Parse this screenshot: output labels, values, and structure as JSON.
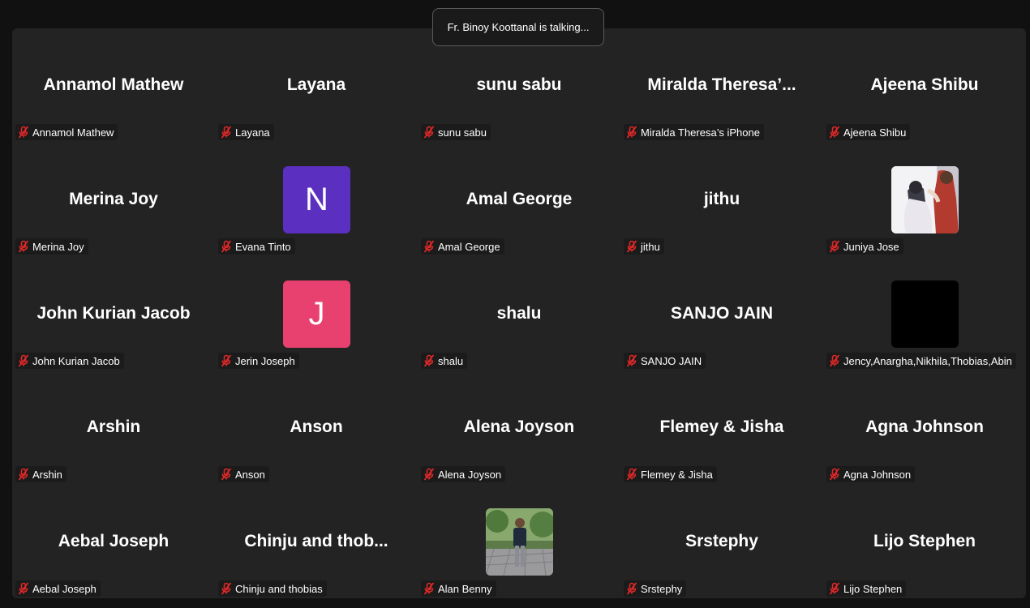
{
  "status": {
    "talking": "Fr. Binoy Koottanal is talking..."
  },
  "colors": {
    "stage": "#232323",
    "mute": "#e02828"
  },
  "tiles": [
    {
      "display": "Annamol Mathew",
      "label": "Annamol Mathew"
    },
    {
      "display": "Layana",
      "label": "Layana"
    },
    {
      "display": "sunu sabu",
      "label": "sunu sabu"
    },
    {
      "display": "Miralda  Theresa’...",
      "label": "Miralda Theresa’s iPhone"
    },
    {
      "display": "Ajeena Shibu",
      "label": "Ajeena Shibu"
    },
    {
      "display": "Merina Joy",
      "label": "Merina Joy"
    },
    {
      "avatar_letter": "N",
      "avatar_color": "#5b2fc0",
      "label": "Evana Tinto"
    },
    {
      "display": "Amal George",
      "label": "Amal George"
    },
    {
      "display": "jithu",
      "label": "jithu"
    },
    {
      "avatar_kind": "illustration",
      "label": "Juniya Jose"
    },
    {
      "display": "John Kurian Jacob",
      "label": "John Kurian Jacob"
    },
    {
      "avatar_letter": "J",
      "avatar_color": "#e8416f",
      "label": "Jerin Joseph"
    },
    {
      "display": "shalu",
      "label": "shalu"
    },
    {
      "display": "SANJO JAIN",
      "label": "SANJO JAIN"
    },
    {
      "avatar_kind": "black",
      "label": "Jency,Anargha,Nikhila,Thobias,Abin"
    },
    {
      "display": "Arshin",
      "label": "Arshin"
    },
    {
      "display": "Anson",
      "label": "Anson"
    },
    {
      "display": "Alena Joyson",
      "label": "Alena Joyson"
    },
    {
      "display": "Flemey & Jisha",
      "label": "Flemey & Jisha"
    },
    {
      "display": "Agna Johnson",
      "label": "Agna Johnson"
    },
    {
      "display": "Aebal Joseph",
      "label": "Aebal Joseph"
    },
    {
      "display": "Chinju  and  thob...",
      "label": "Chinju and thobias"
    },
    {
      "avatar_kind": "photo",
      "label": "Alan Benny"
    },
    {
      "display": "Srstephy",
      "label": "Srstephy"
    },
    {
      "display": "Lijo Stephen",
      "label": "Lijo Stephen"
    }
  ]
}
